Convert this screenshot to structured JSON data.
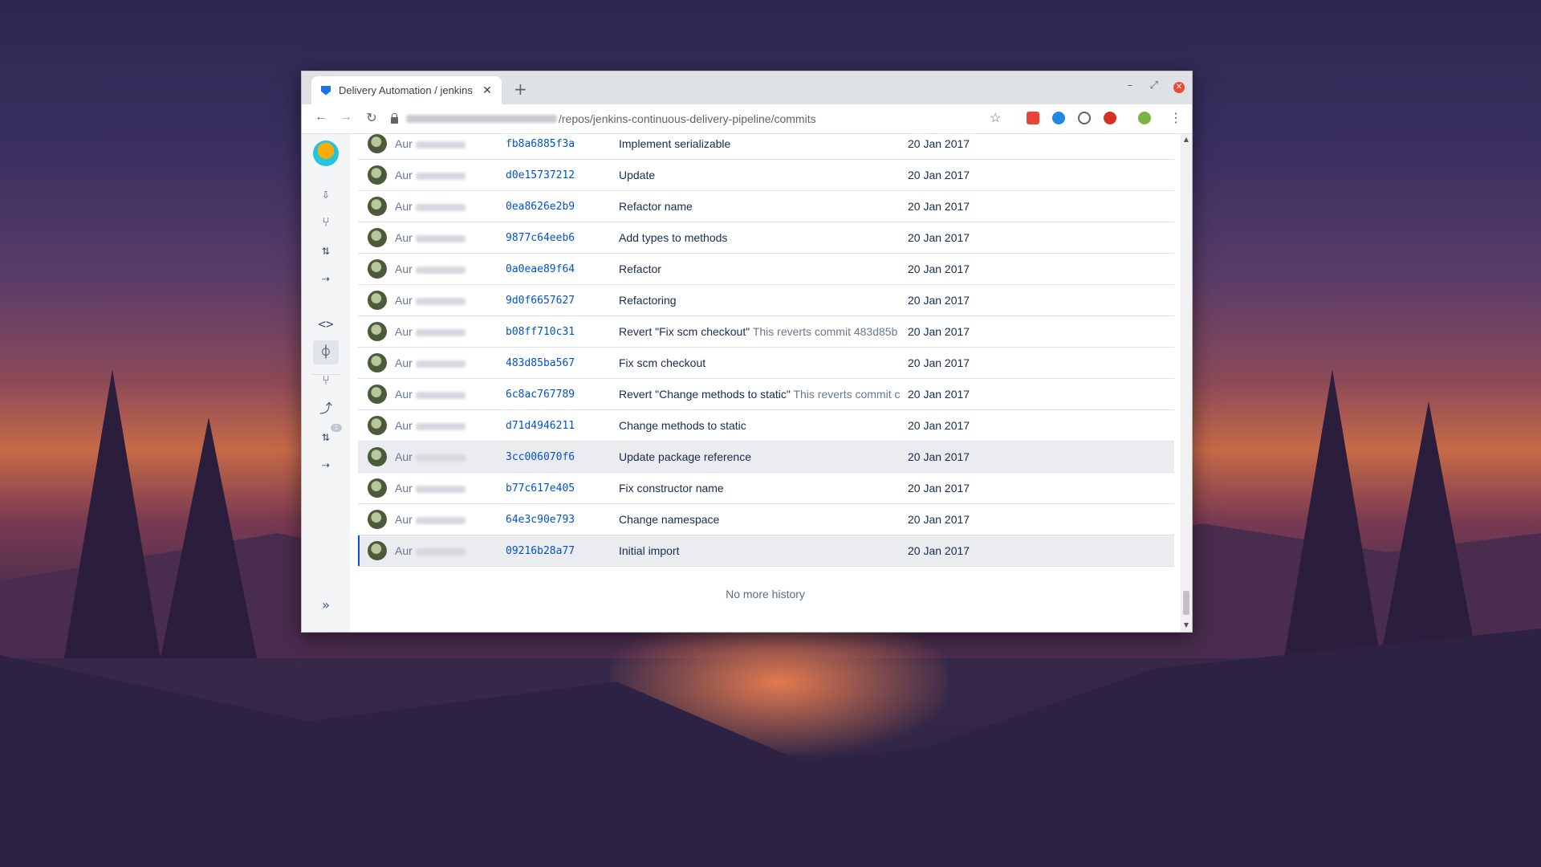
{
  "browser": {
    "tab_title": "Delivery Automation / jenkins",
    "tab_close": "✕",
    "new_tab": "+",
    "url_path": "/repos/jenkins-continuous-delivery-pipeline/commits",
    "minimize": "–",
    "restore": "⤢",
    "close": "✕"
  },
  "nav": {
    "back": "←",
    "forward": "→",
    "reload": "↻",
    "star": "☆",
    "menu": "⋮"
  },
  "sidebar": {
    "icons": [
      "repo-download-icon",
      "branches-icon",
      "pull-requests-icon",
      "forks-icon",
      "source-icon",
      "commits-icon",
      "branches-icon",
      "pipelines-icon",
      "pull-requests-icon",
      "forks-icon"
    ],
    "pr_badge": "1",
    "expand": "»"
  },
  "commits": [
    {
      "author": "Aur",
      "hash": "fb8a6885f3a",
      "message": "Implement serializable",
      "desc": "",
      "date": "20 Jan 2017",
      "state": ""
    },
    {
      "author": "Aur",
      "hash": "d0e15737212",
      "message": "Update",
      "desc": "",
      "date": "20 Jan 2017",
      "state": ""
    },
    {
      "author": "Aur",
      "hash": "0ea8626e2b9",
      "message": "Refactor name",
      "desc": "",
      "date": "20 Jan 2017",
      "state": ""
    },
    {
      "author": "Aur",
      "hash": "9877c64eeb6",
      "message": "Add types to methods",
      "desc": "",
      "date": "20 Jan 2017",
      "state": ""
    },
    {
      "author": "Aur",
      "hash": "0a0eae89f64",
      "message": "Refactor",
      "desc": "",
      "date": "20 Jan 2017",
      "state": ""
    },
    {
      "author": "Aur",
      "hash": "9d0f6657627",
      "message": "Refactoring",
      "desc": "",
      "date": "20 Jan 2017",
      "state": ""
    },
    {
      "author": "Aur",
      "hash": "b08ff710c31",
      "message": "Revert \"Fix scm checkout\"",
      "desc": " This reverts commit 483d85b",
      "date": "20 Jan 2017",
      "state": ""
    },
    {
      "author": "Aur",
      "hash": "483d85ba567",
      "message": "Fix scm checkout",
      "desc": "",
      "date": "20 Jan 2017",
      "state": ""
    },
    {
      "author": "Aur",
      "hash": "6c8ac767789",
      "message": "Revert \"Change methods to static\"",
      "desc": " This reverts commit c",
      "date": "20 Jan 2017",
      "state": ""
    },
    {
      "author": "Aur",
      "hash": "d71d4946211",
      "message": "Change methods to static",
      "desc": "",
      "date": "20 Jan 2017",
      "state": ""
    },
    {
      "author": "Aur",
      "hash": "3cc006070f6",
      "message": "Update package reference",
      "desc": "",
      "date": "20 Jan 2017",
      "state": "hl"
    },
    {
      "author": "Aur",
      "hash": "b77c617e405",
      "message": "Fix constructor name",
      "desc": "",
      "date": "20 Jan 2017",
      "state": ""
    },
    {
      "author": "Aur",
      "hash": "64e3c90e793",
      "message": "Change namespace",
      "desc": "",
      "date": "20 Jan 2017",
      "state": ""
    },
    {
      "author": "Aur",
      "hash": "09216b28a77",
      "message": "Initial import",
      "desc": "",
      "date": "20 Jan 2017",
      "state": "sel"
    }
  ],
  "footer": {
    "no_more": "No more history"
  },
  "colors": {
    "link": "#0052cc",
    "text": "#172b4d",
    "muted": "#6b778c",
    "accent_close": "#e94b3c"
  }
}
